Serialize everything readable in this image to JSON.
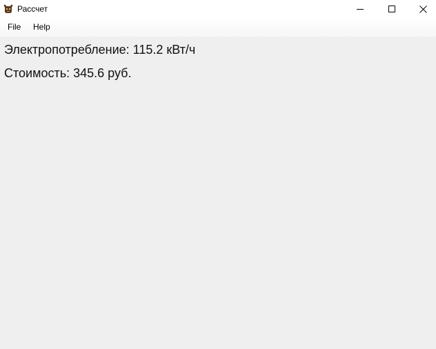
{
  "window": {
    "title": "Рассчет",
    "icon": "buffalo-icon"
  },
  "controls": {
    "minimize_icon": "minimize-icon",
    "maximize_icon": "maximize-icon",
    "close_icon": "close-icon"
  },
  "menu": {
    "items": [
      {
        "label": "File"
      },
      {
        "label": "Help"
      }
    ]
  },
  "content": {
    "power": "Электропотребление: 115.2 кВт/ч",
    "cost": "Стоимость: 345.6 руб."
  },
  "colors": {
    "titlebar": "#ffffff",
    "background": "#efefef",
    "text": "#111111"
  }
}
